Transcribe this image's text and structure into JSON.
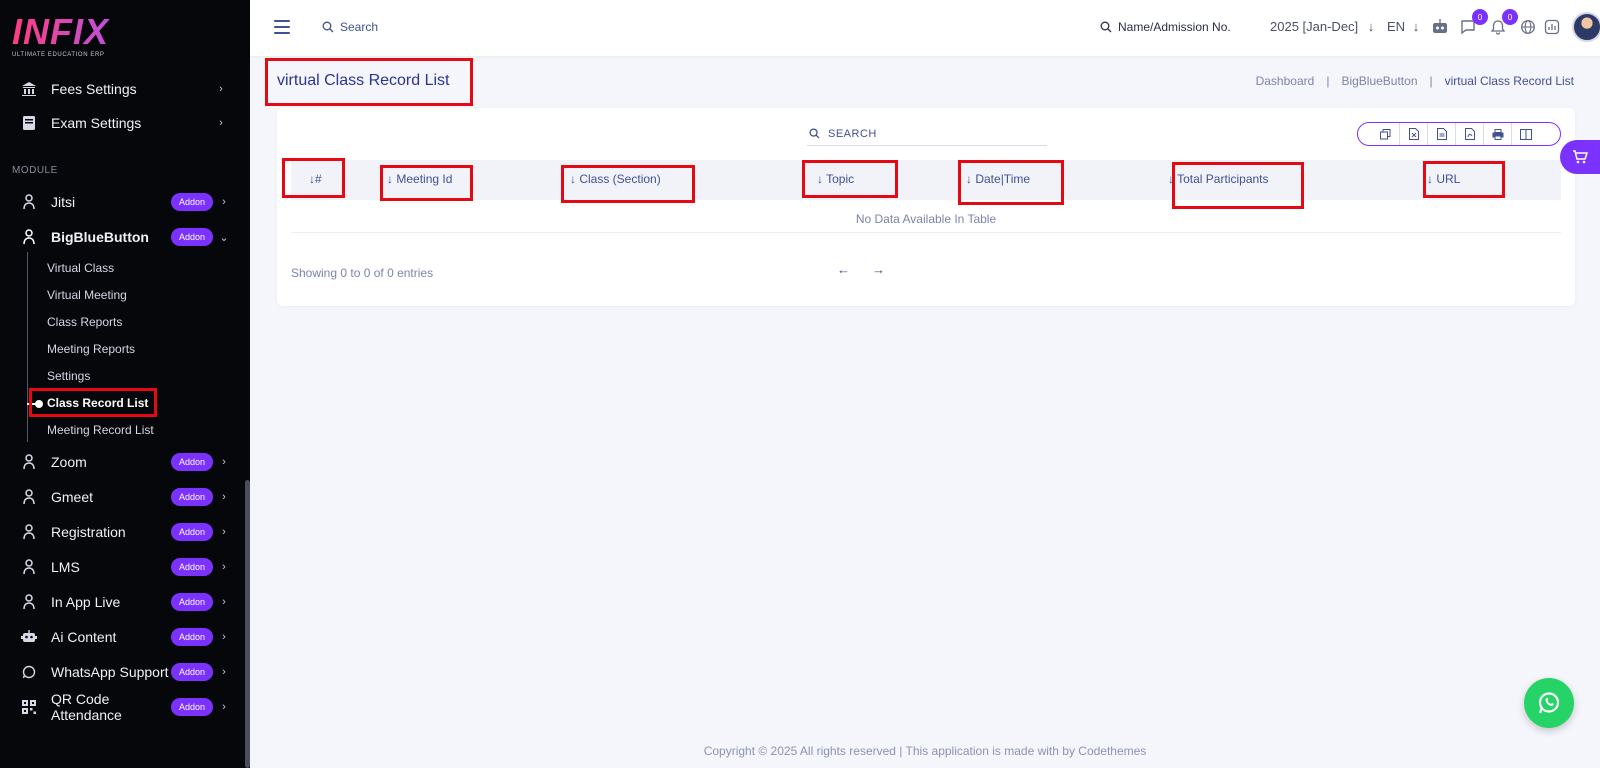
{
  "brand": {
    "logo_text": "INFIX",
    "tagline": "ULTIMATE EDUCATION ERP"
  },
  "sidebar": {
    "top_items": [
      {
        "label": "Fees Settings",
        "icon": "bank-icon"
      },
      {
        "label": "Exam Settings",
        "icon": "book-icon"
      }
    ],
    "module_label": "MODULE",
    "modules": [
      {
        "label": "Jitsi",
        "badge": "Addon",
        "icon": "user-plug-icon"
      },
      {
        "label": "BigBlueButton",
        "badge": "Addon",
        "icon": "user-plug-icon",
        "expanded": true
      },
      {
        "label": "Zoom",
        "badge": "Addon",
        "icon": "user-plug-icon"
      },
      {
        "label": "Gmeet",
        "badge": "Addon",
        "icon": "user-plug-icon"
      },
      {
        "label": "Registration",
        "badge": "Addon",
        "icon": "user-plug-icon"
      },
      {
        "label": "LMS",
        "badge": "Addon",
        "icon": "user-plug-icon"
      },
      {
        "label": "In App Live",
        "badge": "Addon",
        "icon": "user-plug-icon"
      },
      {
        "label": "Ai Content",
        "badge": "Addon",
        "icon": "robot-icon"
      },
      {
        "label": "WhatsApp Support",
        "badge": "Addon",
        "icon": "whatsapp-icon"
      },
      {
        "label": "QR Code Attendance",
        "badge": "Addon",
        "icon": "qr-icon"
      }
    ],
    "submenu": [
      {
        "label": "Virtual Class"
      },
      {
        "label": "Virtual Meeting"
      },
      {
        "label": "Class Reports"
      },
      {
        "label": "Meeting Reports"
      },
      {
        "label": "Settings"
      },
      {
        "label": "Class Record List",
        "current": true
      },
      {
        "label": "Meeting Record List"
      }
    ]
  },
  "topbar": {
    "search_placeholder": "Search",
    "admission_search": "Name/Admission No.",
    "session": "2025 [Jan-Dec]",
    "language": "EN",
    "chat_count": "0",
    "notification_count": "0"
  },
  "page": {
    "title": "virtual Class Record List",
    "breadcrumb": [
      "Dashboard",
      "BigBlueButton",
      "virtual Class Record List"
    ]
  },
  "table": {
    "search_label": "SEARCH",
    "columns": [
      "#",
      "Meeting Id",
      "Class (Section)",
      "Topic",
      "Date|Time",
      "Total Participants",
      "URL"
    ],
    "sort_glyph": "↓",
    "empty_text": "No Data Available In Table",
    "showing_text": "Showing 0 to 0 of 0 entries",
    "export_buttons": [
      "copy-icon",
      "excel-icon",
      "csv-icon",
      "pdf-icon",
      "print-icon",
      "columns-icon"
    ]
  },
  "footer": {
    "text": "Copyright © 2025 All rights reserved | This application is made with by Codethemes"
  },
  "colors": {
    "accent": "#7c32ff",
    "sidebar_bg": "#06070b",
    "highlight": "#e50914",
    "text": "#415094",
    "whatsapp": "#25d366"
  }
}
